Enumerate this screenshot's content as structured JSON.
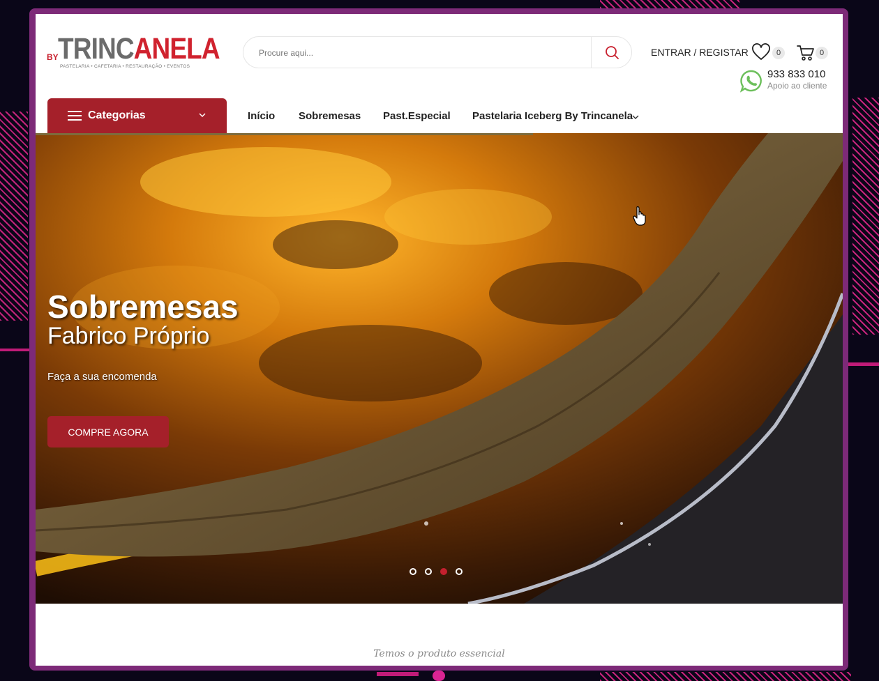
{
  "logo": {
    "by": "BY",
    "word_main": "TRINC",
    "word_accent": "ANELA",
    "tagline": "PASTELARIA • CAFETARIA • RESTAURAÇÃO • EVENTOS"
  },
  "search": {
    "placeholder": "Procure aqui..."
  },
  "account": {
    "label": "ENTRAR / REGISTAR"
  },
  "wishlist": {
    "count": "0"
  },
  "cart": {
    "count": "0"
  },
  "contact": {
    "phone": "933 833 010",
    "label": "Apoio ao cliente"
  },
  "nav": {
    "categories_label": "Categorias",
    "items": [
      "Início",
      "Sobremesas",
      "Past.Especial",
      "Pastelaria Iceberg By Trincanela"
    ]
  },
  "hero": {
    "title": "Sobremesas",
    "subtitle": "Fabrico Próprio",
    "description": "Faça a sua encomenda",
    "cta": "COMPRE AGORA",
    "slides": 4,
    "active_slide": 3
  },
  "section": {
    "tagline": "Temos o produto essencial"
  },
  "colors": {
    "brand_red": "#a5202a",
    "accent_red": "#d0222e",
    "whatsapp_green": "#6cbf5b",
    "frame_purple": "#7d2a78"
  }
}
